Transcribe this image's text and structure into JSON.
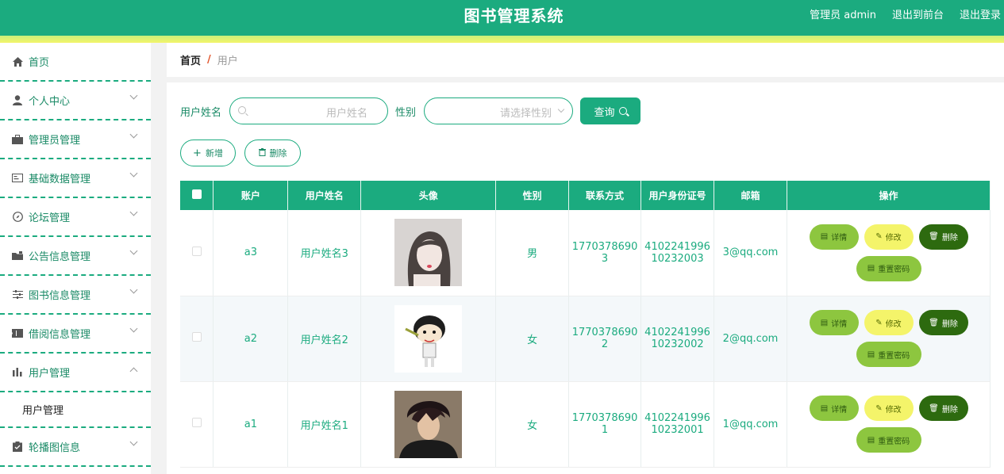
{
  "header": {
    "title": "图书管理系统",
    "admin": "管理员 admin",
    "to_front": "退出到前台",
    "logout": "退出登录"
  },
  "sidebar": {
    "items": [
      {
        "label": "首页",
        "icon": "home-icon"
      },
      {
        "label": "个人中心",
        "icon": "user-icon"
      },
      {
        "label": "管理员管理",
        "icon": "briefcase-icon"
      },
      {
        "label": "基础数据管理",
        "icon": "card-icon"
      },
      {
        "label": "论坛管理",
        "icon": "compass-icon"
      },
      {
        "label": "公告信息管理",
        "icon": "folder-icon"
      },
      {
        "label": "图书信息管理",
        "icon": "sliders-icon"
      },
      {
        "label": "借阅信息管理",
        "icon": "ticket-icon"
      },
      {
        "label": "用户管理",
        "icon": "chart-icon"
      },
      {
        "label": "轮播图信息",
        "icon": "clipboard-icon"
      }
    ],
    "submenu_label": "用户管理"
  },
  "breadcrumb": {
    "home": "首页",
    "sep": "/",
    "current": "用户"
  },
  "search": {
    "name_label": "用户姓名",
    "name_placeholder": "用户姓名",
    "gender_label": "性别",
    "gender_placeholder": "请选择性别",
    "query_label": "查询"
  },
  "actions": {
    "add_label": "新增",
    "delete_label": "删除"
  },
  "table": {
    "headers": [
      "账户",
      "用户姓名",
      "头像",
      "性别",
      "联系方式",
      "用户身份证号",
      "邮箱",
      "操作"
    ],
    "rows": [
      {
        "account": "a3",
        "name": "用户姓名3",
        "gender": "男",
        "phone_1": "1770378690",
        "phone_2": "3",
        "id_1": "4102241996",
        "id_2": "10232003",
        "email": "3@qq.com"
      },
      {
        "account": "a2",
        "name": "用户姓名2",
        "gender": "女",
        "phone_1": "1770378690",
        "phone_2": "2",
        "id_1": "4102241996",
        "id_2": "10232002",
        "email": "2@qq.com"
      },
      {
        "account": "a1",
        "name": "用户姓名1",
        "gender": "女",
        "phone_1": "1770378690",
        "phone_2": "1",
        "id_1": "4102241996",
        "id_2": "10232001",
        "email": "1@qq.com"
      }
    ],
    "op_detail": "详情",
    "op_edit": "修改",
    "op_delete": "删除",
    "op_reset": "重置密码"
  },
  "colors": {
    "primary": "#1bab7f",
    "yellow": "#f4f46a",
    "lime": "#8dc63f",
    "dark_green": "#2d6a0f"
  }
}
